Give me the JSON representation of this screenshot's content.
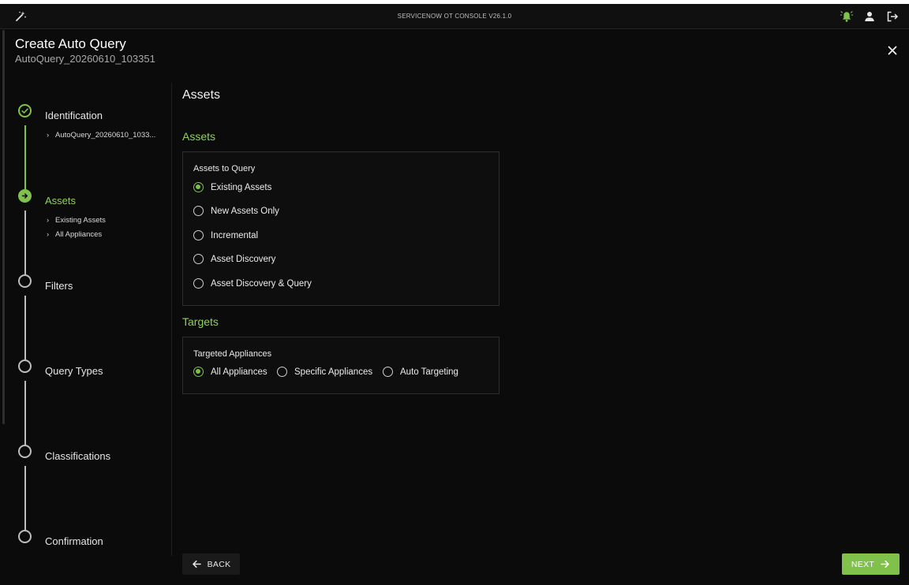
{
  "app": {
    "title": "SERVICENOW OT CONSOLE V26.1.0",
    "logo_icon": "magic-wand-icon",
    "icons": [
      "alarm-bell-icon",
      "user-icon",
      "logout-icon"
    ],
    "accent_color": "#7fc14b",
    "bell_color": "#7fc14b"
  },
  "header": {
    "title": "Create Auto Query",
    "subtitle": "AutoQuery_20260610_103351",
    "close_icon": "close-icon"
  },
  "steps": [
    {
      "label": "Identification",
      "status": "done",
      "subs": [
        "AutoQuery_20260610_1033..."
      ]
    },
    {
      "label": "Assets",
      "status": "active",
      "subs": [
        "Existing Assets",
        "All Appliances"
      ]
    },
    {
      "label": "Filters",
      "status": "pending",
      "subs": []
    },
    {
      "label": "Query Types",
      "status": "pending",
      "subs": []
    },
    {
      "label": "Classifications",
      "status": "pending",
      "subs": []
    },
    {
      "label": "Confirmation",
      "status": "pending",
      "subs": []
    }
  ],
  "content": {
    "title": "Assets",
    "assets_section": {
      "title": "Assets",
      "card_label": "Assets to Query",
      "options": [
        "Existing Assets",
        "New Assets Only",
        "Incremental",
        "Asset Discovery",
        "Asset Discovery & Query"
      ],
      "selected": "Existing Assets"
    },
    "targets_section": {
      "title": "Targets",
      "card_label": "Targeted Appliances",
      "options": [
        "All Appliances",
        "Specific Appliances",
        "Auto Targeting"
      ],
      "selected": "All Appliances"
    }
  },
  "footer": {
    "back_label": "BACK",
    "next_label": "NEXT"
  }
}
